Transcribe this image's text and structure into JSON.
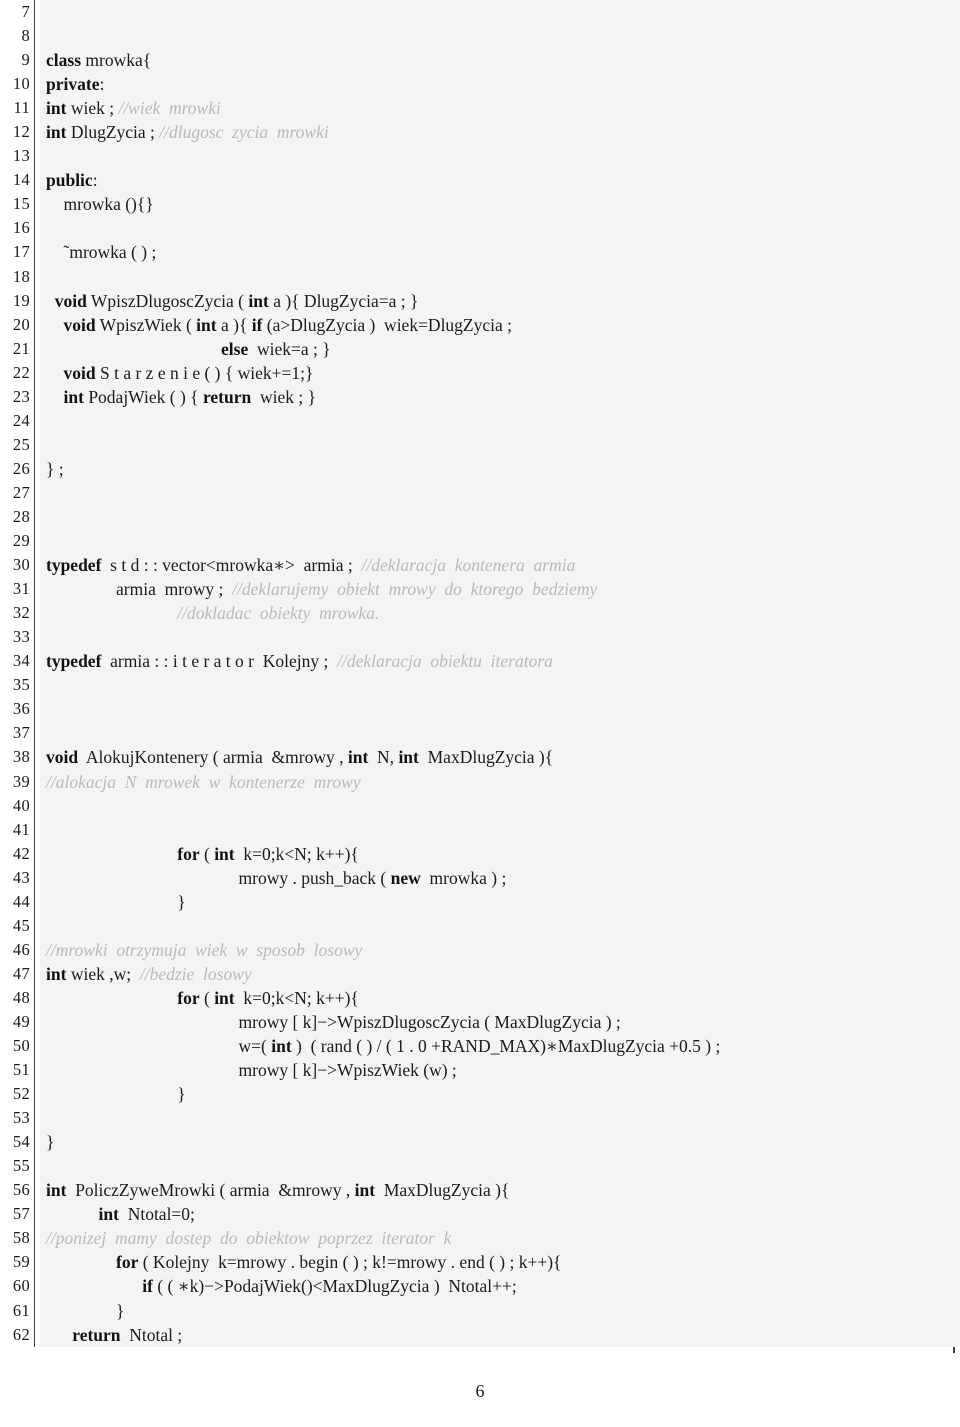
{
  "document": {
    "page_number": "6",
    "language": "C++",
    "listing_background": "#f4f4f4",
    "text_color": "#1b1b1b",
    "comment_color": "#b9b9b9",
    "rule_color": "#3d3d3d"
  },
  "listing": {
    "first_line_number": 7,
    "last_line_number": 62,
    "lines": [
      {
        "n": "7",
        "indent": 0,
        "tokens": []
      },
      {
        "n": "8",
        "indent": 0,
        "tokens": []
      },
      {
        "n": "9",
        "indent": 0,
        "tokens": [
          {
            "t": "kw",
            "s": "class"
          },
          {
            "t": "pln",
            "s": " mrowka{"
          }
        ]
      },
      {
        "n": "10",
        "indent": 0,
        "tokens": [
          {
            "t": "kw",
            "s": "private"
          },
          {
            "t": "pln",
            "s": ":"
          }
        ]
      },
      {
        "n": "11",
        "indent": 0,
        "tokens": [
          {
            "t": "kw",
            "s": "int"
          },
          {
            "t": "pln",
            "s": " wiek ; "
          },
          {
            "t": "cmt",
            "s": "//wiek  mrowki"
          }
        ]
      },
      {
        "n": "12",
        "indent": 0,
        "tokens": [
          {
            "t": "kw",
            "s": "int"
          },
          {
            "t": "pln",
            "s": " DlugZycia ; "
          },
          {
            "t": "cmt",
            "s": "//dlugosc  zycia  mrowki"
          }
        ]
      },
      {
        "n": "13",
        "indent": 0,
        "tokens": []
      },
      {
        "n": "14",
        "indent": 0,
        "tokens": [
          {
            "t": "kw",
            "s": "public"
          },
          {
            "t": "pln",
            "s": ":"
          }
        ]
      },
      {
        "n": "15",
        "indent": 2,
        "tokens": [
          {
            "t": "pln",
            "s": "mrowka (){}"
          }
        ]
      },
      {
        "n": "16",
        "indent": 0,
        "tokens": []
      },
      {
        "n": "17",
        "indent": 2,
        "tokens": [
          {
            "t": "pln",
            "s": "˜mrowka ( ) ;"
          }
        ]
      },
      {
        "n": "18",
        "indent": 0,
        "tokens": []
      },
      {
        "n": "19",
        "indent": 1,
        "tokens": [
          {
            "t": "kw",
            "s": "void"
          },
          {
            "t": "pln",
            "s": " WpiszDlugoscZycia ( "
          },
          {
            "t": "kw",
            "s": "int"
          },
          {
            "t": "pln",
            "s": " a ){ DlugZycia=a ; }"
          }
        ]
      },
      {
        "n": "20",
        "indent": 2,
        "tokens": [
          {
            "t": "kw",
            "s": "void"
          },
          {
            "t": "pln",
            "s": " WpiszWiek ( "
          },
          {
            "t": "kw",
            "s": "int"
          },
          {
            "t": "pln",
            "s": " a ){ "
          },
          {
            "t": "kw",
            "s": "if"
          },
          {
            "t": "pln",
            "s": " (a>DlugZycia )  wiek=DlugZycia ;"
          }
        ]
      },
      {
        "n": "21",
        "indent": 20,
        "tokens": [
          {
            "t": "kw",
            "s": "else"
          },
          {
            "t": "pln",
            "s": "  wiek=a ; }"
          }
        ]
      },
      {
        "n": "22",
        "indent": 2,
        "tokens": [
          {
            "t": "kw",
            "s": "void"
          },
          {
            "t": "pln",
            "s": " S t a r z e n i e ( ) { wiek+=1;}"
          }
        ]
      },
      {
        "n": "23",
        "indent": 2,
        "tokens": [
          {
            "t": "kw",
            "s": "int"
          },
          {
            "t": "pln",
            "s": " PodajWiek ( ) { "
          },
          {
            "t": "kw",
            "s": "return"
          },
          {
            "t": "pln",
            "s": "  wiek ; }"
          }
        ]
      },
      {
        "n": "24",
        "indent": 0,
        "tokens": []
      },
      {
        "n": "25",
        "indent": 0,
        "tokens": []
      },
      {
        "n": "26",
        "indent": 0,
        "tokens": [
          {
            "t": "pln",
            "s": "} ;"
          }
        ]
      },
      {
        "n": "27",
        "indent": 0,
        "tokens": []
      },
      {
        "n": "28",
        "indent": 0,
        "tokens": []
      },
      {
        "n": "29",
        "indent": 0,
        "tokens": []
      },
      {
        "n": "30",
        "indent": 0,
        "tokens": [
          {
            "t": "kw",
            "s": "typedef"
          },
          {
            "t": "pln",
            "s": "  s t d : : vector<mrowka∗>  armia ;  "
          },
          {
            "t": "cmt",
            "s": "//deklaracja  kontenera  armia"
          }
        ]
      },
      {
        "n": "31",
        "indent": 8,
        "tokens": [
          {
            "t": "pln",
            "s": "armia  mrowy ;  "
          },
          {
            "t": "cmt",
            "s": "//deklarujemy  obiekt  mrowy  do  ktorego  bedziemy"
          }
        ]
      },
      {
        "n": "32",
        "indent": 15,
        "tokens": [
          {
            "t": "cmt",
            "s": "//dokladac  obiekty  mrowka."
          }
        ]
      },
      {
        "n": "33",
        "indent": 0,
        "tokens": []
      },
      {
        "n": "34",
        "indent": 0,
        "tokens": [
          {
            "t": "kw",
            "s": "typedef"
          },
          {
            "t": "pln",
            "s": "  armia : : i t e r a t o r  Kolejny ;  "
          },
          {
            "t": "cmt",
            "s": "//deklaracja  obiektu  iteratora"
          }
        ]
      },
      {
        "n": "35",
        "indent": 0,
        "tokens": []
      },
      {
        "n": "36",
        "indent": 0,
        "tokens": []
      },
      {
        "n": "37",
        "indent": 0,
        "tokens": []
      },
      {
        "n": "38",
        "indent": 0,
        "tokens": [
          {
            "t": "kw",
            "s": "void"
          },
          {
            "t": "pln",
            "s": "  AlokujKontenery ( armia  &mrowy , "
          },
          {
            "t": "kw",
            "s": "int"
          },
          {
            "t": "pln",
            "s": "  N, "
          },
          {
            "t": "kw",
            "s": "int"
          },
          {
            "t": "pln",
            "s": "  MaxDlugZycia ){"
          }
        ]
      },
      {
        "n": "39",
        "indent": 0,
        "tokens": [
          {
            "t": "cmt",
            "s": "//alokacja  N  mrowek  w  kontenerze  mrowy"
          }
        ]
      },
      {
        "n": "40",
        "indent": 0,
        "tokens": []
      },
      {
        "n": "41",
        "indent": 0,
        "tokens": []
      },
      {
        "n": "42",
        "indent": 15,
        "tokens": [
          {
            "t": "kw",
            "s": "for"
          },
          {
            "t": "pln",
            "s": " ( "
          },
          {
            "t": "kw",
            "s": "int"
          },
          {
            "t": "pln",
            "s": "  k=0;k<N; k++){"
          }
        ]
      },
      {
        "n": "43",
        "indent": 22,
        "tokens": [
          {
            "t": "pln",
            "s": "mrowy . push_back ( "
          },
          {
            "t": "kw",
            "s": "new"
          },
          {
            "t": "pln",
            "s": "  mrowka ) ;"
          }
        ]
      },
      {
        "n": "44",
        "indent": 15,
        "tokens": [
          {
            "t": "pln",
            "s": "}"
          }
        ]
      },
      {
        "n": "45",
        "indent": 0,
        "tokens": []
      },
      {
        "n": "46",
        "indent": 0,
        "tokens": [
          {
            "t": "cmt",
            "s": "//mrowki  otrzymuja  wiek  w  sposob  losowy"
          }
        ]
      },
      {
        "n": "47",
        "indent": 0,
        "tokens": [
          {
            "t": "kw",
            "s": "int"
          },
          {
            "t": "pln",
            "s": " wiek ,w;  "
          },
          {
            "t": "cmt",
            "s": "//bedzie  losowy"
          }
        ]
      },
      {
        "n": "48",
        "indent": 15,
        "tokens": [
          {
            "t": "kw",
            "s": "for"
          },
          {
            "t": "pln",
            "s": " ( "
          },
          {
            "t": "kw",
            "s": "int"
          },
          {
            "t": "pln",
            "s": "  k=0;k<N; k++){"
          }
        ]
      },
      {
        "n": "49",
        "indent": 22,
        "tokens": [
          {
            "t": "pln",
            "s": "mrowy [ k]−>WpiszDlugoscZycia ( MaxDlugZycia ) ;"
          }
        ]
      },
      {
        "n": "50",
        "indent": 22,
        "tokens": [
          {
            "t": "pln",
            "s": "w=( "
          },
          {
            "t": "kw",
            "s": "int"
          },
          {
            "t": "pln",
            "s": " )  ( rand ( ) / ( 1 . 0 +RAND_MAX)∗MaxDlugZycia +0.5 ) ;"
          }
        ]
      },
      {
        "n": "51",
        "indent": 22,
        "tokens": [
          {
            "t": "pln",
            "s": "mrowy [ k]−>WpiszWiek (w) ;"
          }
        ]
      },
      {
        "n": "52",
        "indent": 15,
        "tokens": [
          {
            "t": "pln",
            "s": "}"
          }
        ]
      },
      {
        "n": "53",
        "indent": 0,
        "tokens": []
      },
      {
        "n": "54",
        "indent": 0,
        "tokens": [
          {
            "t": "pln",
            "s": "}"
          }
        ]
      },
      {
        "n": "55",
        "indent": 0,
        "tokens": []
      },
      {
        "n": "56",
        "indent": 0,
        "tokens": [
          {
            "t": "kw",
            "s": "int"
          },
          {
            "t": "pln",
            "s": "  PoliczZyweMrowki ( armia  &mrowy , "
          },
          {
            "t": "kw",
            "s": "int"
          },
          {
            "t": "pln",
            "s": "  MaxDlugZycia ){"
          }
        ]
      },
      {
        "n": "57",
        "indent": 6,
        "tokens": [
          {
            "t": "kw",
            "s": "int"
          },
          {
            "t": "pln",
            "s": "  Ntotal=0;"
          }
        ]
      },
      {
        "n": "58",
        "indent": 0,
        "tokens": [
          {
            "t": "cmt",
            "s": "//ponizej  mamy  dostep  do  obiektow  poprzez  iterator  k"
          }
        ]
      },
      {
        "n": "59",
        "indent": 8,
        "tokens": [
          {
            "t": "kw",
            "s": "for"
          },
          {
            "t": "pln",
            "s": " ( Kolejny  k=mrowy . begin ( ) ; k!=mrowy . end ( ) ; k++){"
          }
        ]
      },
      {
        "n": "60",
        "indent": 11,
        "tokens": [
          {
            "t": "kw",
            "s": "if"
          },
          {
            "t": "pln",
            "s": " ( ( ∗k)−>PodajWiek()<MaxDlugZycia )  Ntotal++;"
          }
        ]
      },
      {
        "n": "61",
        "indent": 8,
        "tokens": [
          {
            "t": "pln",
            "s": "}"
          }
        ]
      },
      {
        "n": "62",
        "indent": 3,
        "tokens": [
          {
            "t": "kw",
            "s": "return"
          },
          {
            "t": "pln",
            "s": "  Ntotal ;"
          }
        ]
      }
    ]
  }
}
